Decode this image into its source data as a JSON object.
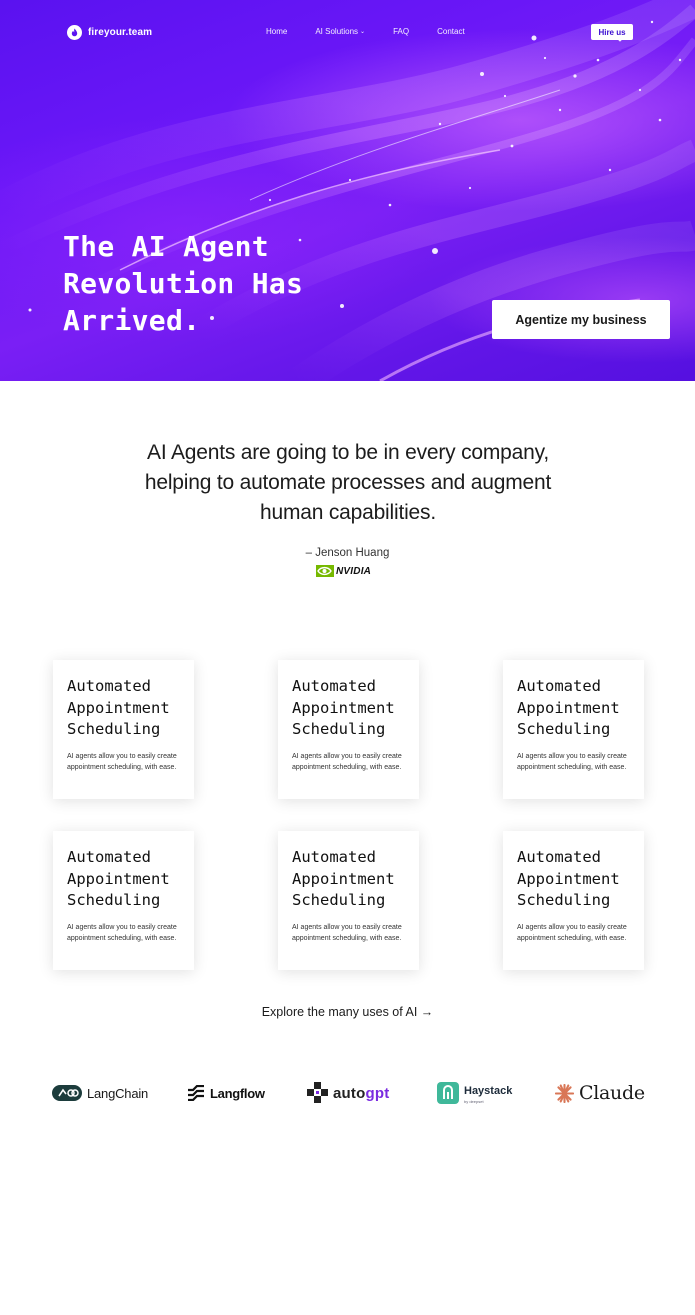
{
  "nav": {
    "brand": "fireyour.team",
    "links": [
      {
        "label": "Home"
      },
      {
        "label": "AI Solutions",
        "has_dropdown": true
      },
      {
        "label": "FAQ"
      },
      {
        "label": "Contact"
      }
    ],
    "hire_label": "Hire us"
  },
  "hero": {
    "title_lines": [
      "The AI Agent",
      "Revolution Has",
      "Arrived."
    ],
    "cta_label": "Agentize my business"
  },
  "quote": {
    "lines": [
      "AI Agents are going to be in every company,",
      "helping to automate processes and augment",
      "human capabilities."
    ],
    "author": "– Jenson Huang",
    "company": "NVIDIA"
  },
  "cards": [
    {
      "title_lines": [
        "Automated",
        "Appointment",
        "Scheduling"
      ],
      "desc": "AI agents allow you to easily create appointment scheduling, with ease."
    },
    {
      "title_lines": [
        "Automated",
        "Appointment",
        "Scheduling"
      ],
      "desc": "AI agents allow you to easily create appointment scheduling, with ease."
    },
    {
      "title_lines": [
        "Automated",
        "Appointment",
        "Scheduling"
      ],
      "desc": "AI agents allow you to easily create appointment scheduling, with ease."
    },
    {
      "title_lines": [
        "Automated",
        "Appointment",
        "Scheduling"
      ],
      "desc": "AI agents allow you to easily create appointment scheduling, with ease."
    },
    {
      "title_lines": [
        "Automated",
        "Appointment",
        "Scheduling"
      ],
      "desc": "AI agents allow you to easily create appointment scheduling, with ease."
    },
    {
      "title_lines": [
        "Automated",
        "Appointment",
        "Scheduling"
      ],
      "desc": "AI agents allow you to easily create appointment scheduling, with ease."
    }
  ],
  "explore_link": "Explore the many uses of AI →",
  "logos": {
    "langchain": "LangChain",
    "langflow": "Langflow",
    "autogpt_a": "auto",
    "autogpt_b": "gpt",
    "haystack": "Haystack",
    "haystack_sub": "by deepset",
    "claude": "Claude"
  },
  "colors": {
    "hero_purple": "#6a17f7",
    "hire_text": "#3b0fd1",
    "nvidia_green": "#76b900",
    "autogpt_purple": "#7a2be0",
    "haystack_teal": "#3fb89a",
    "claude_orange": "#d97757"
  }
}
